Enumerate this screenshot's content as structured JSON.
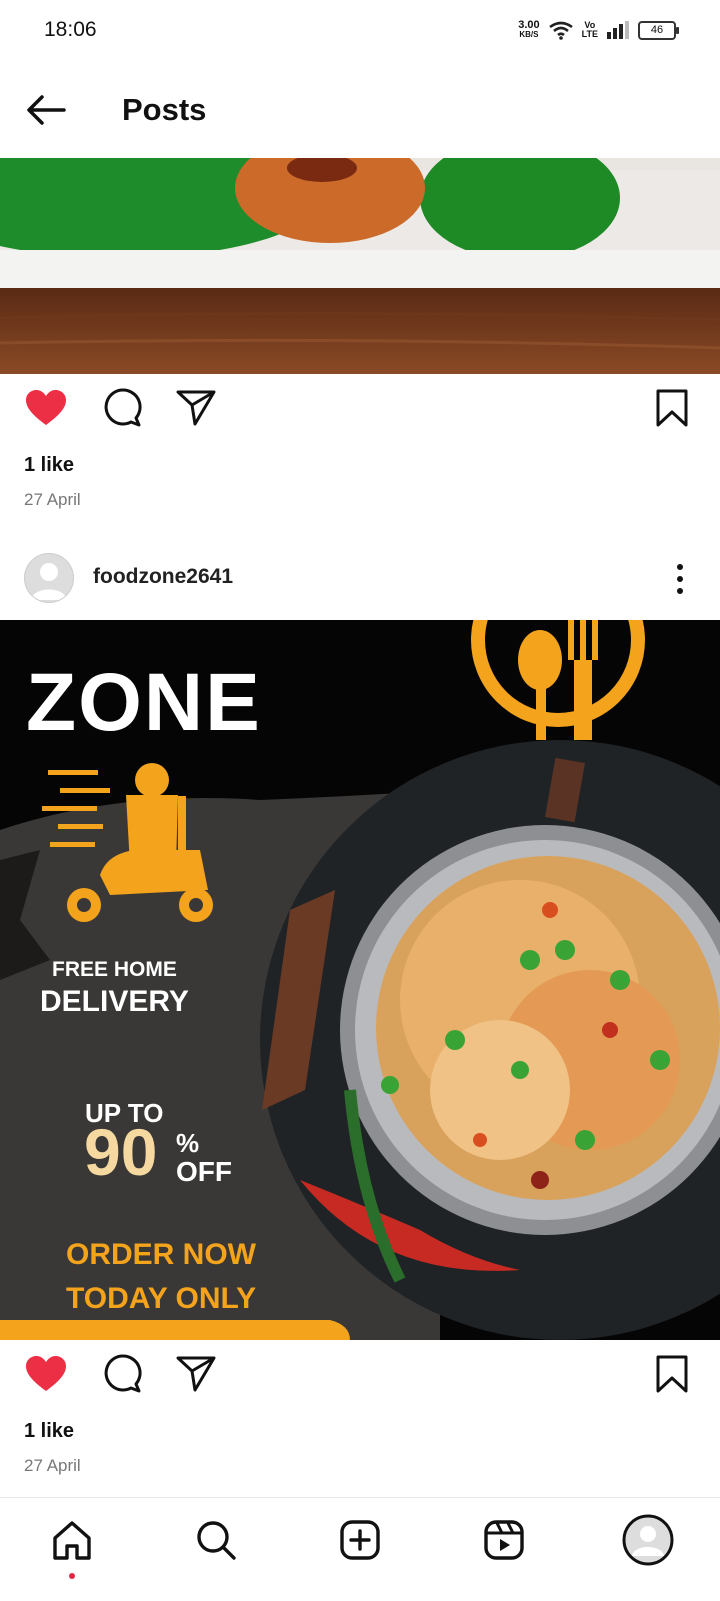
{
  "status_bar": {
    "time": "18:06",
    "speed_value": "3.00",
    "speed_unit": "KB/S",
    "volte_top": "Vo",
    "volte_bottom": "LTE",
    "battery": "46"
  },
  "header": {
    "title": "Posts"
  },
  "post1": {
    "likes": "1 like",
    "date": "27 April",
    "liked": true
  },
  "post2": {
    "username": "foodzone2641",
    "likes": "1 like",
    "date": "27 April",
    "liked": true,
    "image_text": {
      "brand": "ZONE",
      "free": "FREE HOME",
      "delivery": "DELIVERY",
      "upto": "UP TO",
      "discount": "90",
      "pct": "%",
      "off": "OFF",
      "order": "ORDER NOW",
      "today": "TODAY ONLY"
    }
  },
  "colors": {
    "like_red": "#ed2f45",
    "accent_orange": "#f3a31c",
    "dark_bg": "#050505"
  },
  "nav": {
    "items": [
      "home-icon",
      "search-icon",
      "create-icon",
      "reels-icon",
      "profile-avatar"
    ]
  }
}
